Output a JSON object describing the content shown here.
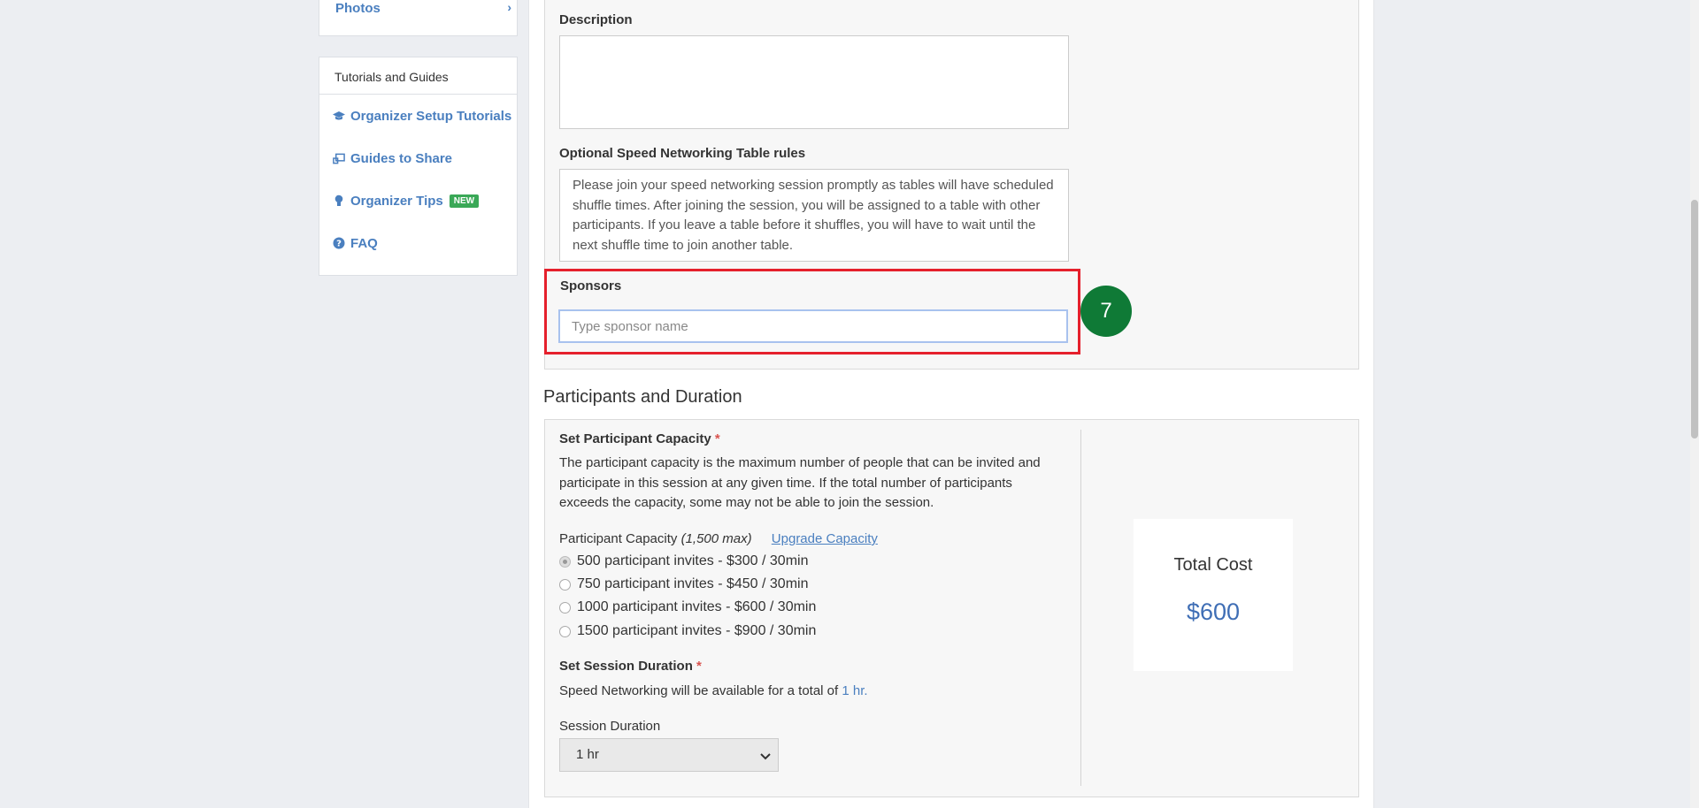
{
  "sidebar": {
    "photos_label": "Photos",
    "tutorials_header": "Tutorials and Guides",
    "items": [
      {
        "label": "Organizer Setup Tutorials",
        "icon": "graduation-cap-icon"
      },
      {
        "label": "Guides to Share",
        "icon": "screen-share-icon"
      },
      {
        "label": "Organizer Tips",
        "icon": "lightbulb-icon",
        "badge": "NEW"
      },
      {
        "label": "FAQ",
        "icon": "question-circle-icon"
      }
    ]
  },
  "form": {
    "description_label": "Description",
    "description_value": "",
    "rules_label": "Optional Speed Networking Table rules",
    "rules_value": "Please join your speed networking session promptly as tables will have scheduled shuffle times. After joining the session, you will be assigned to a table with other participants. If you leave a table before it shuffles, you will have to wait until the next shuffle time to join another table.",
    "sponsors_label": "Sponsors",
    "sponsors_placeholder": "Type sponsor name",
    "step_number": "7"
  },
  "participants": {
    "section_title": "Participants and Duration",
    "capacity_title": "Set Participant Capacity",
    "required_mark": "*",
    "capacity_desc": "The participant capacity is the maximum number of people that can be invited and participate in this session at any given time. If the total number of participants exceeds the capacity, some may not be able to join the session.",
    "capacity_label": "Participant Capacity",
    "capacity_max": "(1,500 max)",
    "upgrade_link": "Upgrade Capacity",
    "options": [
      {
        "label": "500 participant invites - $300 / 30min",
        "checked": true
      },
      {
        "label": "750 participant invites - $450 / 30min",
        "checked": false
      },
      {
        "label": "1000 participant invites - $600 / 30min",
        "checked": false
      },
      {
        "label": "1500 participant invites - $900 / 30min",
        "checked": false
      }
    ],
    "duration_title": "Set Session Duration",
    "duration_text": "Speed Networking will be available for a total of",
    "duration_value": "1 hr.",
    "duration_select_label": "Session Duration",
    "duration_selected": "1 hr"
  },
  "cost": {
    "title": "Total Cost",
    "value": "$600"
  },
  "colors": {
    "accent": "#4a7fbf",
    "highlight": "#e5202c",
    "step": "#0f7a36",
    "badge": "#3aa857"
  }
}
